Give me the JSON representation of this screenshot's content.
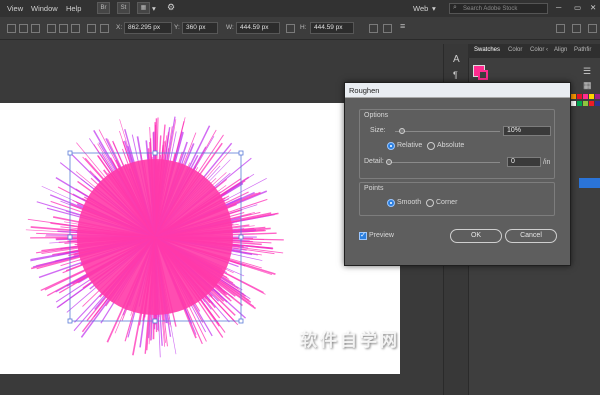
{
  "menu": {
    "view": "View",
    "window": "Window",
    "help": "Help",
    "workspace": "Web",
    "search_placeholder": "Search Adobe Stock"
  },
  "app_icons": {
    "br": "Br",
    "st": "St"
  },
  "control": {
    "x_label": "X:",
    "x_value": "862.295 px",
    "y_label": "Y:",
    "y_value": "360 px",
    "w_label": "W:",
    "w_value": "444.59 px",
    "h_label": "H:",
    "h_value": "444.59 px"
  },
  "panel": {
    "tabs": [
      "Swatches",
      "Color",
      "Color ‹",
      "Align",
      "Pathfir"
    ]
  },
  "swatch_colors": [
    "#ff9a00",
    "#e5132d",
    "#ff2c90",
    "#ffd200",
    "#a11e8a",
    "#ffffff",
    "#00a651",
    "#8dc63f",
    "#ed1c24",
    "#2e3192"
  ],
  "dialog": {
    "title": "Roughen",
    "options_label": "Options",
    "size_label": "Size:",
    "size_value": "10%",
    "size_fraction": 0.1,
    "relative_label": "Relative",
    "absolute_label": "Absolute",
    "detail_label": "Detail:",
    "detail_value": "0",
    "detail_unit": "/in",
    "points_label": "Points",
    "smooth_label": "Smooth",
    "corner_label": "Corner",
    "preview_label": "Preview",
    "ok_label": "OK",
    "cancel_label": "Cancel"
  },
  "watermark": "软件自学网 WWW.RJZXW.COM",
  "colors": {
    "spike": "#ff2fb6",
    "spike_core": "#ff3aa8",
    "selection": "#5b7bd8",
    "ui_dark": "#323232"
  }
}
